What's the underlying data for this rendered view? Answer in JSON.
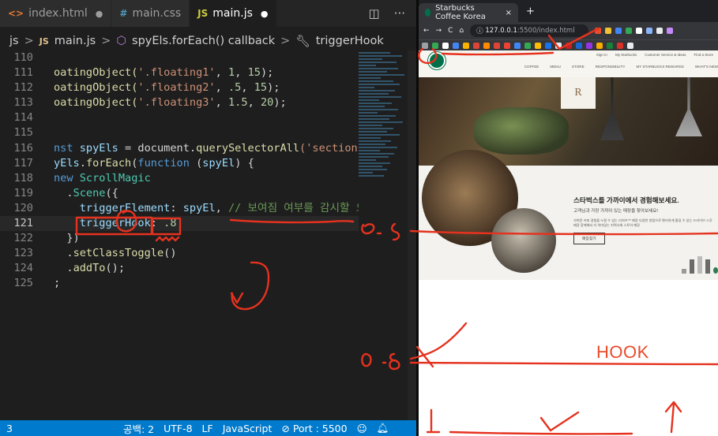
{
  "editor": {
    "tabs": [
      {
        "icon": "<>",
        "label": "index.html",
        "marker": "●"
      },
      {
        "icon": "#",
        "label": "main.css",
        "marker": ""
      },
      {
        "icon": "JS",
        "label": "main.js",
        "marker": "●"
      }
    ],
    "breadcrumb": [
      "js",
      ">",
      "JS",
      "main.js",
      ">",
      "spyEls.forEach() callback",
      ">",
      "triggerHook"
    ],
    "lines": [
      {
        "n": "110"
      },
      {
        "n": "111"
      },
      {
        "n": "112"
      },
      {
        "n": "113"
      },
      {
        "n": "114"
      },
      {
        "n": "115"
      },
      {
        "n": "116"
      },
      {
        "n": "117"
      },
      {
        "n": "118"
      },
      {
        "n": "119"
      },
      {
        "n": "120"
      },
      {
        "n": "121"
      },
      {
        "n": "122"
      },
      {
        "n": "123"
      },
      {
        "n": "124"
      },
      {
        "n": "125"
      }
    ],
    "code": {
      "l111a": "oatingObject(",
      "l111s": "'.floating1'",
      "l111b": ", ",
      "l111n1": "1",
      "l111c": ", ",
      "l111n2": "15",
      "l111d": ");",
      "l112a": "oatingObject(",
      "l112s": "'.floating2'",
      "l112b": ", ",
      "l112n1": ".5",
      "l112c": ", ",
      "l112n2": "15",
      "l112d": ");",
      "l113a": "oatingObject(",
      "l113s": "'.floating3'",
      "l113b": ", ",
      "l113n1": "1.5",
      "l113c": ", ",
      "l113n2": "20",
      "l113d": ");",
      "l116k": "nst ",
      "l116v": "spyEls",
      "l116a": " = document.",
      "l116f": "querySelectorAll",
      "l116s": "('section.sc",
      "l117v": "yEls",
      "l117a": ".",
      "l117f": "forEach",
      "l117b": "(",
      "l117k": "function",
      "l117c": " (",
      "l117p": "spyEl",
      "l117d": ") {",
      "l118k": "new ",
      "l118c": "ScrollMagic",
      "l119a": ".",
      "l119c": "Scene",
      "l119b": "({",
      "l120v": "triggerElement",
      "l120a": ": ",
      "l120p": "spyEl",
      "l120b": ", ",
      "l120c": "// 보여짐 여부를 감시할 요소를",
      "l121v": "triggerHook",
      "l121a": ": ",
      "l121n": ".8",
      "l122a": "})",
      "l123a": ".",
      "l123f": "setClassToggle",
      "l123b": "()",
      "l124a": ".",
      "l124f": "addTo",
      "l124b": "();",
      "l125a": ";"
    },
    "status": {
      "line_col": "3",
      "spaces": "공백: 2",
      "encoding": "UTF-8",
      "eol": "LF",
      "language": "JavaScript",
      "port": "⊘ Port : 5500"
    }
  },
  "browser": {
    "tab_title": "Starbucks Coffee Korea",
    "tab_close": "×",
    "new_tab": "+",
    "url_host": "127.0.0.1",
    "url_path": ":5500/index.html",
    "nav": {
      "back": "←",
      "forward": "→",
      "reload": "C",
      "home": "⌂"
    }
  },
  "site": {
    "sub_menu": [
      "Sign In",
      "My Starbucks",
      "Customer Service & Ideas",
      "Find a Store"
    ],
    "main_menu": [
      "COFFEE",
      "MENU",
      "STORE",
      "RESPONSIBILITY",
      "MY STARBUCKS REWARDS",
      "WHAT'S NEW"
    ],
    "hero_card": "R",
    "store_title": "스타벅스를 가까이에서 경험해보세요.",
    "store_sub": "고객님과 가장 가까이 있는 매장을 찾아보세요!",
    "store_body": "가벼운 커피 경험을 누릴 수 있는 리저브™ 매장 다양한 방법으로 편리하게 즐길 수 있는 드라이브 스루 매장 함께해서 더 의미있는 지역사회 스토어 매장",
    "store_button": "매장찾기"
  },
  "annotations": {
    "hook": "HOOK",
    "zero_five": "0.5",
    "zero_eight": "0.8",
    "zero": "0",
    "one": "1"
  },
  "colors": {
    "ink": "#e5321f",
    "status_bar": "#007acc",
    "starbucks_green": "#00704a"
  }
}
